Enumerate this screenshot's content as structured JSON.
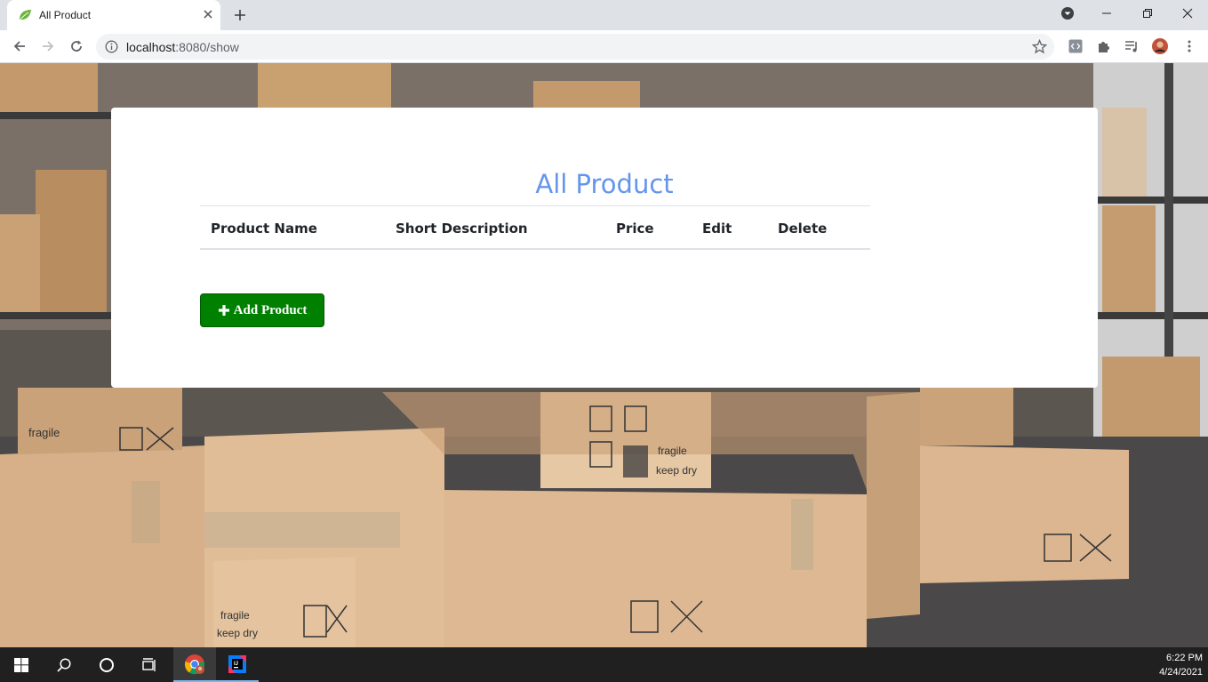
{
  "browser": {
    "tab_title": "All Product",
    "url_host": "localhost",
    "url_rest": ":8080/show"
  },
  "page": {
    "title": "All Product",
    "table": {
      "columns": [
        "Product Name",
        "Short Description",
        "Price",
        "Edit",
        "Delete"
      ],
      "rows": []
    },
    "add_button_label": "Add Product"
  },
  "taskbar": {
    "time": "6:22 PM",
    "date": "4/24/2021"
  },
  "colors": {
    "title": "#6495ed",
    "add_button": "#008000"
  }
}
